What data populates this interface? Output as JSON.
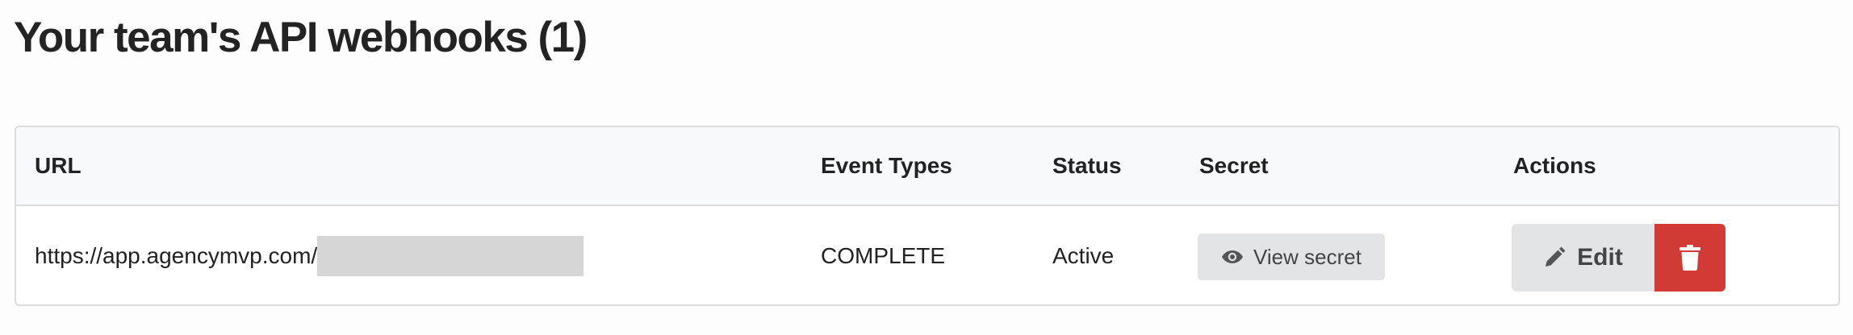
{
  "page": {
    "title": "Your team's API webhooks (1)"
  },
  "table": {
    "columns": [
      "URL",
      "Event Types",
      "Status",
      "Secret",
      "Actions"
    ],
    "rows": [
      {
        "url": "https://app.agencymvp.com/",
        "event_types": "COMPLETE",
        "status": "Active",
        "secret_button_label": "View secret",
        "edit_button_label": "Edit"
      }
    ]
  },
  "icons": {
    "secret": "eye-icon",
    "edit": "pencil-icon",
    "delete": "trash-icon"
  },
  "colors": {
    "delete_button": "#d23a36",
    "secondary_button": "#e3e4e6",
    "header_background": "#f8f9fa"
  }
}
